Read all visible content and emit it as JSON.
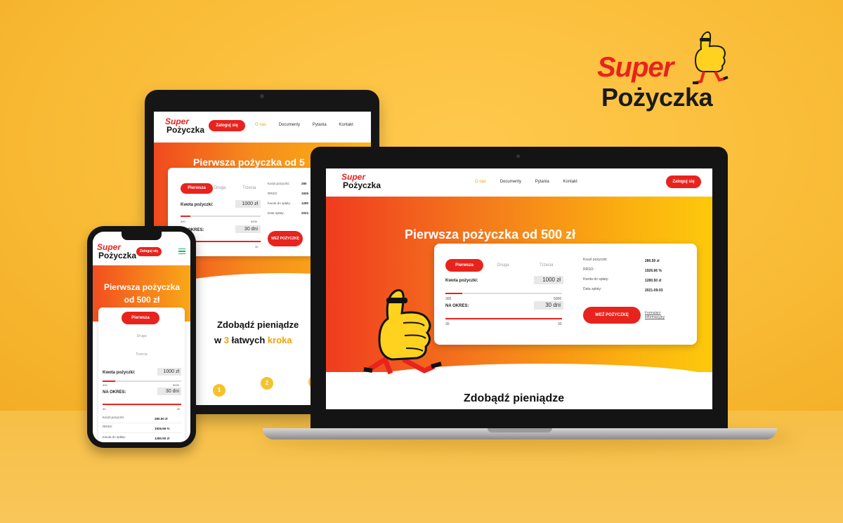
{
  "brand": {
    "super": "Super",
    "name": "Pożyczka"
  },
  "colors": {
    "accent": "#e8231d",
    "orange": "#f47a1c",
    "yellow": "#fbb812"
  },
  "nav": {
    "links": [
      "O nas",
      "Documenty",
      "Pytania",
      "Kontakt"
    ],
    "login": "Zaloguj się"
  },
  "hero": {
    "title": "Pierwsza pożyczka od 500 zł",
    "title_tablet": "Pierwsza pożyczka od 5",
    "title_phone_1": "Pierwsza pożyczka",
    "title_phone_2": "od 500 zł"
  },
  "calc": {
    "tabs": [
      "Pierwsza",
      "Druga",
      "Trzecia"
    ],
    "amount_label": "Kwota pożyczki:",
    "amount_value": "1000 zł",
    "amount_min": "300",
    "amount_max": "5000",
    "period_label": "NA OKRES:",
    "period_value": "30 dni",
    "period_min": "30",
    "period_max": "30",
    "info": [
      {
        "label": "Koszt pożyczki:",
        "value": "280.50 zł"
      },
      {
        "label": "RRSO:",
        "value": "1926.66 %"
      },
      {
        "label": "Kwota do spłaty:",
        "value": "1280.50 zł"
      },
      {
        "label": "Data spłaty:",
        "value": "2021-09-03"
      }
    ],
    "tablet_info_values": [
      "280",
      "1926",
      "1280",
      "2021-"
    ],
    "take_button": "WEŹ POŻYCZKĘ",
    "take_button_tablet": "WEŹ POŻYCZKĘ",
    "form_link": "Formularz informacyjny"
  },
  "section": {
    "title": "Zdobądź pieniądze",
    "sub_prefix": "w",
    "sub_num": "3",
    "sub_mid": "łatwych",
    "sub_end": "kroka",
    "steps": [
      "1",
      "2",
      "3"
    ]
  },
  "icons": [
    "thumbs-up-mascot-icon",
    "hamburger-menu-icon",
    "camera-icon"
  ]
}
